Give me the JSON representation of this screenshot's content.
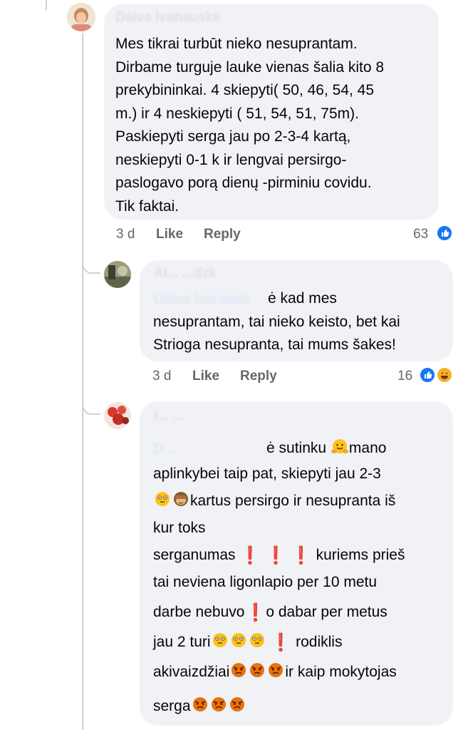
{
  "comment1": {
    "author": "Daiva Ivanauskė",
    "lines": [
      "Mes tikrai turbūt nieko nesuprantam.",
      "Dirbame turguje lauke vienas šalia kito 8",
      "prekybininkai. 4 skiepyti( 50, 46, 54, 45",
      "m.) ir 4 neskiepyti ( 51, 54, 51, 75m).",
      "Paskiepyti serga jau po 2-3-4 kartą,",
      "neskiepyti 0-1 k ir lengvai persirgo-",
      "paslogavo  porą dienų -pirminiu covidu.",
      "Tik faktai."
    ],
    "time": "3 d",
    "like": "Like",
    "reply": "Reply",
    "reaction_count": "63",
    "reactions": [
      "like"
    ]
  },
  "reply1": {
    "author": "Al... ...dzk",
    "mention": "Daiva Ivanausk",
    "line1_rest": "ė kad mes",
    "lines": [
      "nesuprantam, tai nieko keisto, bet kai",
      "Strioga nesupranta, tai mums šakes!"
    ],
    "time": "3 d",
    "like": "Like",
    "reply": "Reply",
    "reaction_count": "16",
    "reactions": [
      "like",
      "haha"
    ]
  },
  "reply2": {
    "author": "I... ...",
    "mention": "D...",
    "t1": "ė sutinku",
    "t2": "mano",
    "l2": "aplinkybei taip pat, skiepyti jau 2-3",
    "l3": "kartus persirgo ir nesupranta iš",
    "l4": "kur toks",
    "l5": "serganumas",
    "l5b": "kuriems prieš",
    "l6": "tai neviena ligonlapio per 10 metu",
    "l7a": "darbe nebuvo",
    "l7b": "o dabar per metus",
    "l8a": "jau 2 turi",
    "l8b": "rodiklis",
    "l9a": "akivaizdžiai",
    "l9b": "ir kaip mokytojas",
    "l10": "serga",
    "excl": "❗"
  },
  "colors": {
    "like_blue": "#1877f2",
    "haha_yellow": "#f7b125",
    "angry_red": "#e9710f"
  }
}
